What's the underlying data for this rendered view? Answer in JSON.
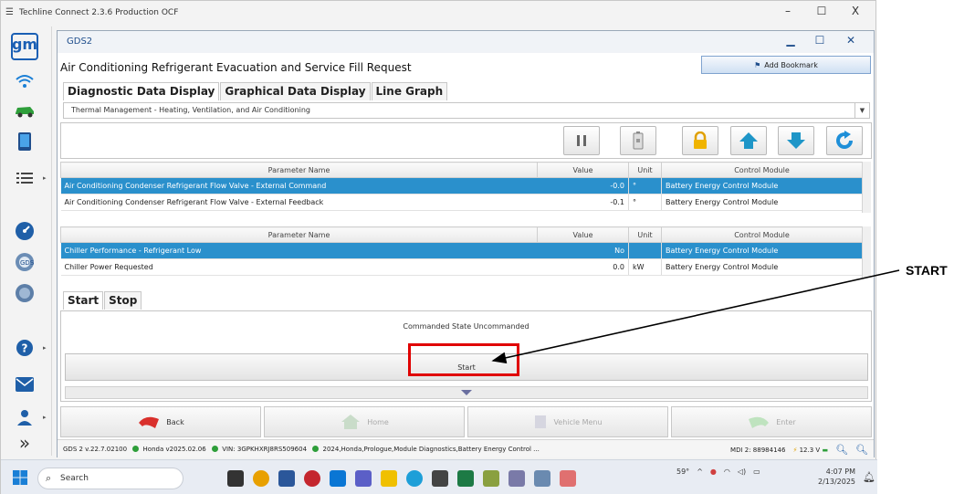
{
  "outer_window": {
    "title": "Techline Connect 2.3.6 Production OCF",
    "minimize": "–",
    "maximize": "☐",
    "close": "X"
  },
  "sidebar": {
    "logo": "gm"
  },
  "gds_window": {
    "title": "GDS2",
    "minimize": "▁",
    "maximize": "☐",
    "close": "✕"
  },
  "page_title": "Air Conditioning Refrigerant Evacuation and Service Fill Request",
  "bookmark_label": "Add Bookmark",
  "tabs": [
    "Diagnostic Data Display",
    "Graphical Data Display",
    "Line Graph"
  ],
  "module_select": "Thermal Management - Heating, Ventilation, and Air Conditioning",
  "table1": {
    "headers": [
      "Parameter Name",
      "Value",
      "Unit",
      "Control Module"
    ],
    "rows": [
      {
        "name": "Air Conditioning Condenser Refrigerant Flow Valve - External Command",
        "value": "-0.0",
        "unit": "°",
        "module": "Battery Energy Control Module"
      },
      {
        "name": "Air Conditioning Condenser Refrigerant Flow Valve - External Feedback",
        "value": "-0.1",
        "unit": "°",
        "module": "Battery Energy Control Module"
      }
    ]
  },
  "table2": {
    "headers": [
      "Parameter Name",
      "Value",
      "Unit",
      "Control Module"
    ],
    "rows": [
      {
        "name": "Chiller Performance - Refrigerant Low",
        "value": "No",
        "unit": "",
        "module": "Battery Energy Control Module"
      },
      {
        "name": "Chiller Power Requested",
        "value": "0.0",
        "unit": "kW",
        "module": "Battery Energy Control Module"
      }
    ]
  },
  "control_tabs": [
    "Start",
    "Stop"
  ],
  "commanded_state": "Commanded State  Uncommanded",
  "start_button": "Start",
  "nav": {
    "back": "Back",
    "home": "Home",
    "vehicle_menu": "Vehicle Menu",
    "enter": "Enter"
  },
  "status_bar": {
    "version": "GDS 2 v.22.7.02100",
    "honda": "Honda v2025.02.06",
    "vin": "VIN: 3GPKHXRJ8RS509604",
    "vehicle": "2024,Honda,Prologue,Module Diagnostics,Battery Energy Control ...",
    "mdi": "MDI 2: 88984146",
    "voltage": "12.3 V"
  },
  "taskbar": {
    "search_label": "Search",
    "weather": "59°",
    "time": "4:07 PM",
    "date": "2/13/2025"
  },
  "annotation_label": "START",
  "colors": {
    "selected_row": "#2a90cc",
    "highlight": "#e00000",
    "gm_blue": "#1a5fb4"
  }
}
